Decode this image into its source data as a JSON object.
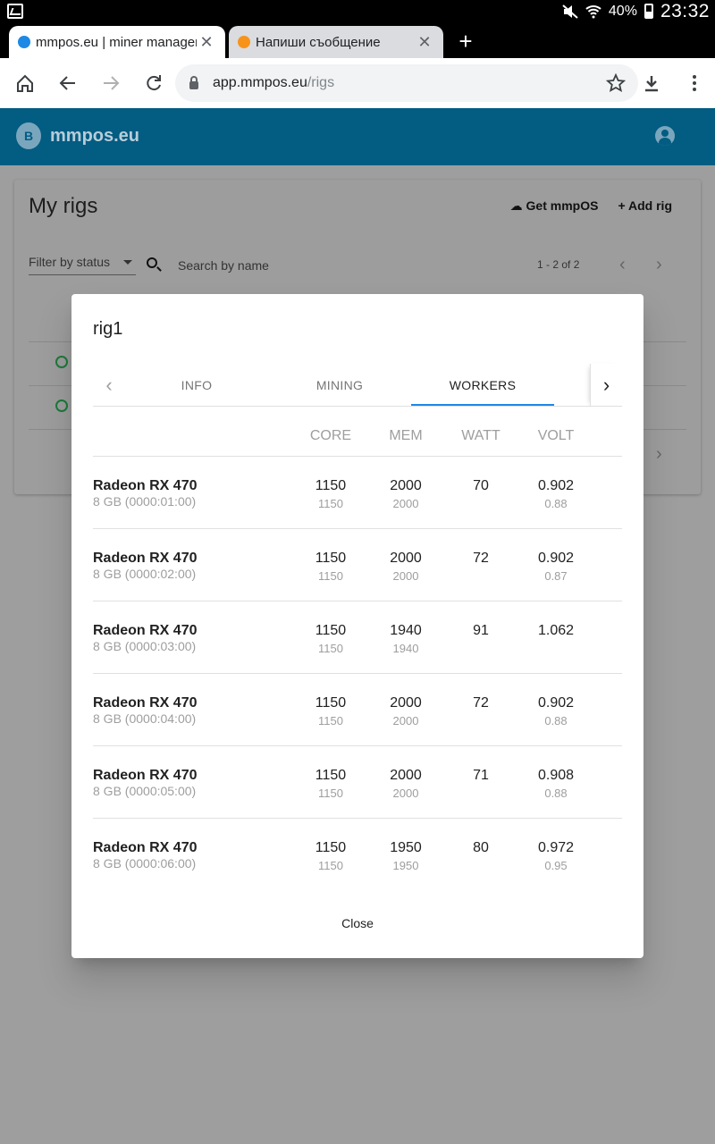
{
  "status_bar": {
    "battery": "40%",
    "time": "23:32"
  },
  "browser": {
    "tabs": [
      {
        "title": "mmpos.eu | miner management",
        "favicon_color": "#1e88e5"
      },
      {
        "title": "Напиши съобщение",
        "favicon_color": "#f7931a"
      }
    ],
    "url": {
      "domain": "app.mmpos.eu",
      "path": "/rigs"
    }
  },
  "app": {
    "brand": "mmpos.eu",
    "header_color": "#035c82",
    "page_title": "My rigs",
    "get_os_label": "Get mmpOS",
    "add_rig_label": "Add rig",
    "filter_label": "Filter by status",
    "search_placeholder": "Search by name",
    "pager": "1 - 2 of 2"
  },
  "modal": {
    "title": "rig1",
    "tabs": [
      "INFO",
      "MINING",
      "WORKERS"
    ],
    "active_tab": "WORKERS",
    "columns": {
      "core": "CORE",
      "mem": "MEM",
      "watt": "WATT",
      "volt": "VOLT"
    },
    "workers": [
      {
        "name": "Radeon RX 470",
        "sub": "8 GB (0000:01:00)",
        "core": "1150",
        "core_sub": "1150",
        "mem": "2000",
        "mem_sub": "2000",
        "watt": "70",
        "volt": "0.902",
        "volt_sub": "0.88"
      },
      {
        "name": "Radeon RX 470",
        "sub": "8 GB (0000:02:00)",
        "core": "1150",
        "core_sub": "1150",
        "mem": "2000",
        "mem_sub": "2000",
        "watt": "72",
        "volt": "0.902",
        "volt_sub": "0.87"
      },
      {
        "name": "Radeon RX 470",
        "sub": "8 GB (0000:03:00)",
        "core": "1150",
        "core_sub": "1150",
        "mem": "1940",
        "mem_sub": "1940",
        "watt": "91",
        "volt": "1.062",
        "volt_sub": ""
      },
      {
        "name": "Radeon RX 470",
        "sub": "8 GB (0000:04:00)",
        "core": "1150",
        "core_sub": "1150",
        "mem": "2000",
        "mem_sub": "2000",
        "watt": "72",
        "volt": "0.902",
        "volt_sub": "0.88"
      },
      {
        "name": "Radeon RX 470",
        "sub": "8 GB (0000:05:00)",
        "core": "1150",
        "core_sub": "1150",
        "mem": "2000",
        "mem_sub": "2000",
        "watt": "71",
        "volt": "0.908",
        "volt_sub": "0.88"
      },
      {
        "name": "Radeon RX 470",
        "sub": "8 GB (0000:06:00)",
        "core": "1150",
        "core_sub": "1150",
        "mem": "1950",
        "mem_sub": "1950",
        "watt": "80",
        "volt": "0.972",
        "volt_sub": "0.95"
      }
    ],
    "close_label": "Close",
    "accent": "#1e88e5"
  }
}
